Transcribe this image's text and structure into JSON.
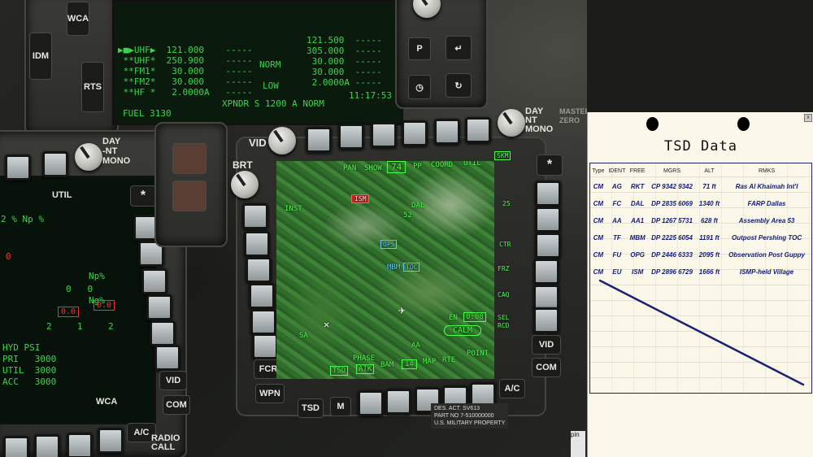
{
  "radio": {
    "rows": [
      {
        "left": "▶■▶UHF▶  121.000    -----",
        "mid": "",
        "right": "121.500  -----"
      },
      {
        "left": " **UHF*  250.900    -----",
        "mid": "NORM",
        "right": "305.000  -----"
      },
      {
        "left": " **FM1*   30.000    -----",
        "mid": "",
        "right": " 30.000  -----"
      },
      {
        "left": " **FM2*   30.000    -----",
        "mid": "LOW",
        "right": " 30.000  -----"
      },
      {
        "left": " **HF *   2.0000A   -----",
        "mid": "",
        "right": " 2.0000A -----"
      }
    ],
    "fuel": "FUEL 3130",
    "xpndr": "XPNDR S 1200 A NORM",
    "time": "11:17:53 Z"
  },
  "cockpit_labels": {
    "wca": "WCA",
    "idm": "IDM",
    "rts": "RTS",
    "p": "P",
    "util": "UTIL",
    "day_nt_mono_left": "DAY\n-NT\nMONO",
    "day_nt_mono_right": "DAY\nNT\nMONO",
    "vid": "VID",
    "brt": "BRT",
    "fcr": "FCR",
    "wpn": "WPN",
    "tsd": "TSD",
    "m": "M",
    "ac": "A/C",
    "com": "COM",
    "vid_right": "VID",
    "com_right": "COM",
    "ac_left": "A/C",
    "radio_call": "RADIO\nCALL",
    "master_zero": "MASTER\nZERO",
    "placard": "DES. ACT. SV613\nPART NO 7-510000000\nU.S. MILITARY PROPERTY"
  },
  "left_mfd": {
    "lines": [
      "Np%",
      "0   0",
      "Ng%",
      "HYD PSI",
      "PRI   3000",
      "UTIL  3000",
      "ACC   3000"
    ],
    "red_values": [
      "0.0",
      "0.0"
    ],
    "misc": [
      "2 % Np %",
      "0",
      "2",
      "1",
      "2"
    ]
  },
  "center_mfd": {
    "top_osb": [
      "PAN",
      "SHOW",
      "74",
      "PP",
      "COORD",
      "UTIL",
      "SKM"
    ],
    "left_osb": [
      "INST",
      "SA"
    ],
    "right_osb": [
      "25",
      "CTR",
      "FRZ",
      "CAQ",
      "SEL",
      "RCD"
    ],
    "bottom_osb": [
      "TSD",
      "PHASE",
      "ATK",
      "BAM",
      "14",
      "MAP",
      "RTE",
      "POINT"
    ],
    "map_symbols": {
      "ism": "ISM",
      "dal": "DAL",
      "dal_num": "52",
      "ops": "OPS",
      "mbm": "MBM",
      "toc": "TOC",
      "en": "EN",
      "en_val": "0:08",
      "calm": "CALM",
      "aa": "AA"
    }
  },
  "kneeboard": {
    "title": "TSD Data",
    "close": "x",
    "columns": [
      "Type",
      "IDENT",
      "FREE",
      "MGRS",
      "ALT",
      "RMKS"
    ],
    "rows": [
      [
        "CM",
        "AG",
        "RKT",
        "CP 9342 9342",
        "71 ft",
        "Ras Al Khaimah Int'l"
      ],
      [
        "CM",
        "FC",
        "DAL",
        "DP 2835 6069",
        "1340 ft",
        "FARP Dallas"
      ],
      [
        "CM",
        "AA",
        "AA1",
        "DP 1267 5731",
        "628 ft",
        "Assembly Area 53"
      ],
      [
        "CM",
        "TF",
        "MBM",
        "DP 2225 6054",
        "1191 ft",
        "Outpost Pershing TOC"
      ],
      [
        "CM",
        "FU",
        "OPG",
        "DP 2446 6333",
        "2095 ft",
        "Observation Post Guppy"
      ],
      [
        "CM",
        "EU",
        "ISM",
        "DP 2896 6729",
        "1666 ft",
        "ISMP-held Village"
      ]
    ],
    "pin_label": "pin"
  }
}
